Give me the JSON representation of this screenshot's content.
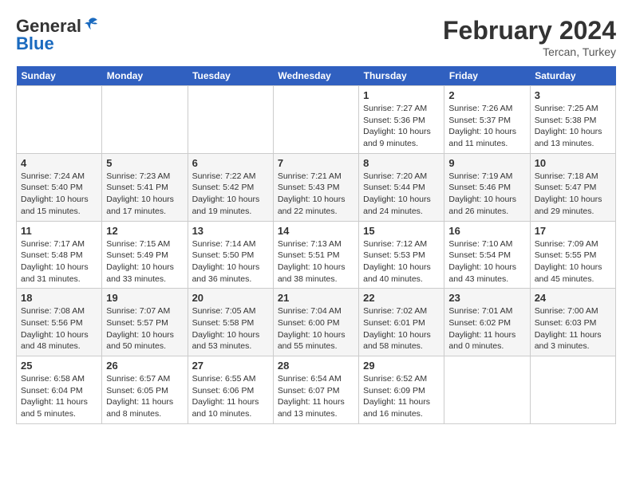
{
  "header": {
    "logo_line1": "General",
    "logo_line2": "Blue",
    "month": "February 2024",
    "location": "Tercan, Turkey"
  },
  "weekdays": [
    "Sunday",
    "Monday",
    "Tuesday",
    "Wednesday",
    "Thursday",
    "Friday",
    "Saturday"
  ],
  "weeks": [
    [
      {
        "day": "",
        "info": ""
      },
      {
        "day": "",
        "info": ""
      },
      {
        "day": "",
        "info": ""
      },
      {
        "day": "",
        "info": ""
      },
      {
        "day": "1",
        "info": "Sunrise: 7:27 AM\nSunset: 5:36 PM\nDaylight: 10 hours and 9 minutes."
      },
      {
        "day": "2",
        "info": "Sunrise: 7:26 AM\nSunset: 5:37 PM\nDaylight: 10 hours and 11 minutes."
      },
      {
        "day": "3",
        "info": "Sunrise: 7:25 AM\nSunset: 5:38 PM\nDaylight: 10 hours and 13 minutes."
      }
    ],
    [
      {
        "day": "4",
        "info": "Sunrise: 7:24 AM\nSunset: 5:40 PM\nDaylight: 10 hours and 15 minutes."
      },
      {
        "day": "5",
        "info": "Sunrise: 7:23 AM\nSunset: 5:41 PM\nDaylight: 10 hours and 17 minutes."
      },
      {
        "day": "6",
        "info": "Sunrise: 7:22 AM\nSunset: 5:42 PM\nDaylight: 10 hours and 19 minutes."
      },
      {
        "day": "7",
        "info": "Sunrise: 7:21 AM\nSunset: 5:43 PM\nDaylight: 10 hours and 22 minutes."
      },
      {
        "day": "8",
        "info": "Sunrise: 7:20 AM\nSunset: 5:44 PM\nDaylight: 10 hours and 24 minutes."
      },
      {
        "day": "9",
        "info": "Sunrise: 7:19 AM\nSunset: 5:46 PM\nDaylight: 10 hours and 26 minutes."
      },
      {
        "day": "10",
        "info": "Sunrise: 7:18 AM\nSunset: 5:47 PM\nDaylight: 10 hours and 29 minutes."
      }
    ],
    [
      {
        "day": "11",
        "info": "Sunrise: 7:17 AM\nSunset: 5:48 PM\nDaylight: 10 hours and 31 minutes."
      },
      {
        "day": "12",
        "info": "Sunrise: 7:15 AM\nSunset: 5:49 PM\nDaylight: 10 hours and 33 minutes."
      },
      {
        "day": "13",
        "info": "Sunrise: 7:14 AM\nSunset: 5:50 PM\nDaylight: 10 hours and 36 minutes."
      },
      {
        "day": "14",
        "info": "Sunrise: 7:13 AM\nSunset: 5:51 PM\nDaylight: 10 hours and 38 minutes."
      },
      {
        "day": "15",
        "info": "Sunrise: 7:12 AM\nSunset: 5:53 PM\nDaylight: 10 hours and 40 minutes."
      },
      {
        "day": "16",
        "info": "Sunrise: 7:10 AM\nSunset: 5:54 PM\nDaylight: 10 hours and 43 minutes."
      },
      {
        "day": "17",
        "info": "Sunrise: 7:09 AM\nSunset: 5:55 PM\nDaylight: 10 hours and 45 minutes."
      }
    ],
    [
      {
        "day": "18",
        "info": "Sunrise: 7:08 AM\nSunset: 5:56 PM\nDaylight: 10 hours and 48 minutes."
      },
      {
        "day": "19",
        "info": "Sunrise: 7:07 AM\nSunset: 5:57 PM\nDaylight: 10 hours and 50 minutes."
      },
      {
        "day": "20",
        "info": "Sunrise: 7:05 AM\nSunset: 5:58 PM\nDaylight: 10 hours and 53 minutes."
      },
      {
        "day": "21",
        "info": "Sunrise: 7:04 AM\nSunset: 6:00 PM\nDaylight: 10 hours and 55 minutes."
      },
      {
        "day": "22",
        "info": "Sunrise: 7:02 AM\nSunset: 6:01 PM\nDaylight: 10 hours and 58 minutes."
      },
      {
        "day": "23",
        "info": "Sunrise: 7:01 AM\nSunset: 6:02 PM\nDaylight: 11 hours and 0 minutes."
      },
      {
        "day": "24",
        "info": "Sunrise: 7:00 AM\nSunset: 6:03 PM\nDaylight: 11 hours and 3 minutes."
      }
    ],
    [
      {
        "day": "25",
        "info": "Sunrise: 6:58 AM\nSunset: 6:04 PM\nDaylight: 11 hours and 5 minutes."
      },
      {
        "day": "26",
        "info": "Sunrise: 6:57 AM\nSunset: 6:05 PM\nDaylight: 11 hours and 8 minutes."
      },
      {
        "day": "27",
        "info": "Sunrise: 6:55 AM\nSunset: 6:06 PM\nDaylight: 11 hours and 10 minutes."
      },
      {
        "day": "28",
        "info": "Sunrise: 6:54 AM\nSunset: 6:07 PM\nDaylight: 11 hours and 13 minutes."
      },
      {
        "day": "29",
        "info": "Sunrise: 6:52 AM\nSunset: 6:09 PM\nDaylight: 11 hours and 16 minutes."
      },
      {
        "day": "",
        "info": ""
      },
      {
        "day": "",
        "info": ""
      }
    ]
  ]
}
